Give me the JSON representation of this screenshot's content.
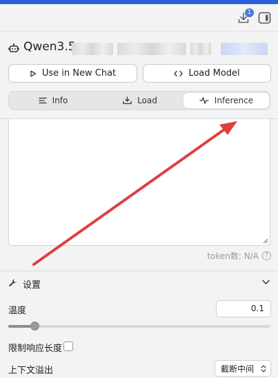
{
  "header": {
    "download_badge_count": "1",
    "download_icon": "download-icon",
    "panel_icon": "panel-toggle-icon"
  },
  "model": {
    "name_prefix": "Qwen3.5-",
    "icon": "robot-icon"
  },
  "actions": {
    "use_in_new_chat": "Use in New Chat",
    "load_model": "Load Model"
  },
  "tabs": [
    {
      "label": "Info",
      "icon": "list-icon"
    },
    {
      "label": "Load",
      "icon": "tray-load-icon"
    },
    {
      "label": "Inference",
      "icon": "activity-icon"
    }
  ],
  "prompt": {
    "token_label": "token数: N/A",
    "help_glyph": "?"
  },
  "settings": {
    "title": "设置",
    "temperature_label": "温度",
    "temperature_value": "0.1",
    "temperature_fraction": 0.1,
    "limit_response_label": "限制响应长度",
    "limit_response_checked": false,
    "context_overflow_label": "上下文溢出",
    "context_overflow_value": "截断中间"
  },
  "colors": {
    "accent": "#2b5fd9",
    "annotation_arrow": "#e03e3e"
  }
}
